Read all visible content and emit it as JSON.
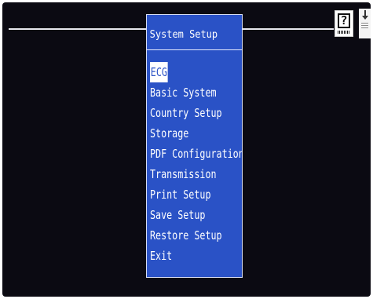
{
  "menu": {
    "title": "System Setup",
    "selected_index": 0,
    "items": [
      {
        "label": "ECG",
        "name": "menu-item-ecg"
      },
      {
        "label": "Basic System",
        "name": "menu-item-basic-system"
      },
      {
        "label": "Country Setup",
        "name": "menu-item-country-setup"
      },
      {
        "label": "Storage",
        "name": "menu-item-storage"
      },
      {
        "label": "PDF Configuration",
        "name": "menu-item-pdf-configuration"
      },
      {
        "label": "Transmission",
        "name": "menu-item-transmission"
      },
      {
        "label": "Print Setup",
        "name": "menu-item-print-setup"
      },
      {
        "label": "Save Setup",
        "name": "menu-item-save-setup"
      },
      {
        "label": "Restore Setup",
        "name": "menu-item-restore-setup"
      },
      {
        "label": "Exit",
        "name": "menu-item-exit"
      }
    ]
  },
  "icons": {
    "help": {
      "name": "help-icon",
      "glyph": "?"
    },
    "document": {
      "name": "download-document-icon"
    }
  },
  "colors": {
    "screen_background": "#0b0a12",
    "menu_background": "#2a52c6",
    "menu_text": "#ffffff"
  }
}
